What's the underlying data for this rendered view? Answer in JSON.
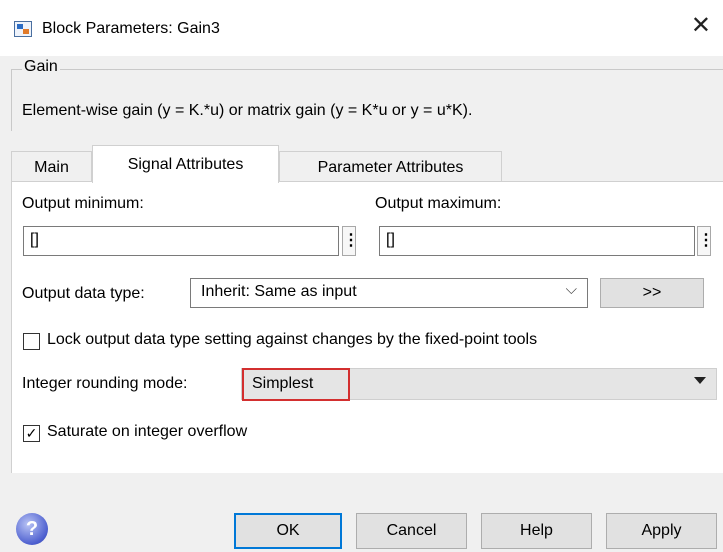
{
  "window": {
    "title": "Block Parameters: Gain3",
    "close_glyph": "✕"
  },
  "group": {
    "label": "Gain",
    "description": "Element-wise gain (y = K.*u) or matrix gain (y = K*u or y = u*K)."
  },
  "tabs": [
    {
      "label": "Main",
      "active": false
    },
    {
      "label": "Signal Attributes",
      "active": true
    },
    {
      "label": "Parameter Attributes",
      "active": false
    }
  ],
  "signal": {
    "output_minimum_label": "Output minimum:",
    "output_minimum_value": "[]",
    "output_maximum_label": "Output maximum:",
    "output_maximum_value": "[]",
    "kebab_glyph": "⋮",
    "output_data_type_label": "Output data type:",
    "output_data_type_value": "Inherit: Same as input",
    "chevron_glyph": "⌵",
    "assistant_button_label": ">>",
    "lock_label": "Lock output data type setting against changes by the fixed-point tools",
    "lock_checked": false,
    "rounding_label": "Integer rounding mode:",
    "rounding_value": "Simplest",
    "saturate_label": "Saturate on integer overflow",
    "saturate_checked": true,
    "check_glyph": "✓"
  },
  "buttons": {
    "ok": "OK",
    "cancel": "Cancel",
    "help": "Help",
    "apply": "Apply",
    "help_icon_glyph": "?"
  },
  "colors": {
    "highlight": "#d32f2f",
    "default_button_border": "#0078d7"
  }
}
